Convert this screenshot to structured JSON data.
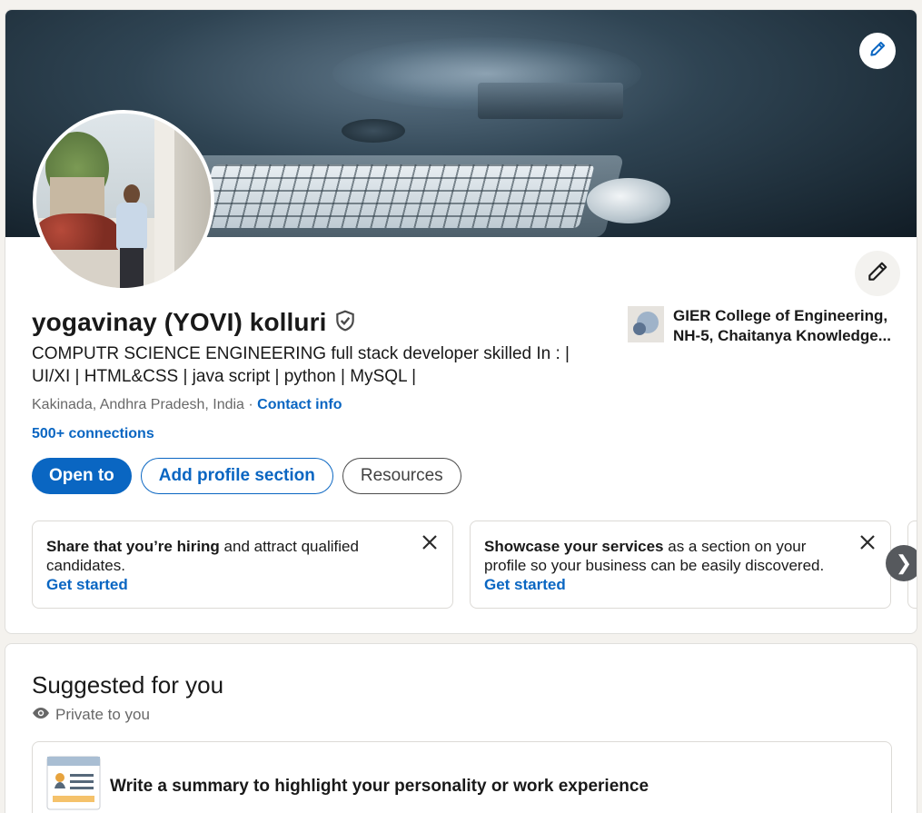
{
  "profile": {
    "name": "yogavinay (YOVI) kolluri",
    "headline": "COMPUTR SCIENCE ENGINEERING full stack developer skilled In : | UI/XI | HTML&CSS | java script | python | MySQL |",
    "location": "Kakinada, Andhra Pradesh, India",
    "separator": " · ",
    "contact_info": "Contact info",
    "connections": "500+ connections",
    "verified_icon": "shield-check-icon"
  },
  "education": {
    "line1": "GIER College of Engineering,",
    "line2": "NH-5, Chaitanya Knowledge..."
  },
  "actions": {
    "open_to": "Open to",
    "add_section": "Add profile section",
    "resources": "Resources"
  },
  "promos": [
    {
      "bold": "Share that you’re hiring",
      "rest": " and attract qualified candidates.",
      "link": "Get started"
    },
    {
      "bold": "Showcase your services",
      "rest": " as a section on your profile so your business can be easily discovered.",
      "link": "Get started"
    }
  ],
  "carousel": {
    "next_glyph": "❯"
  },
  "suggested": {
    "title": "Suggested for you",
    "private": "Private to you",
    "item_text": "Write a summary to highlight your personality or work experience"
  },
  "colors": {
    "brand_blue": "#0a66c2",
    "page_bg": "#f4f2ee"
  }
}
